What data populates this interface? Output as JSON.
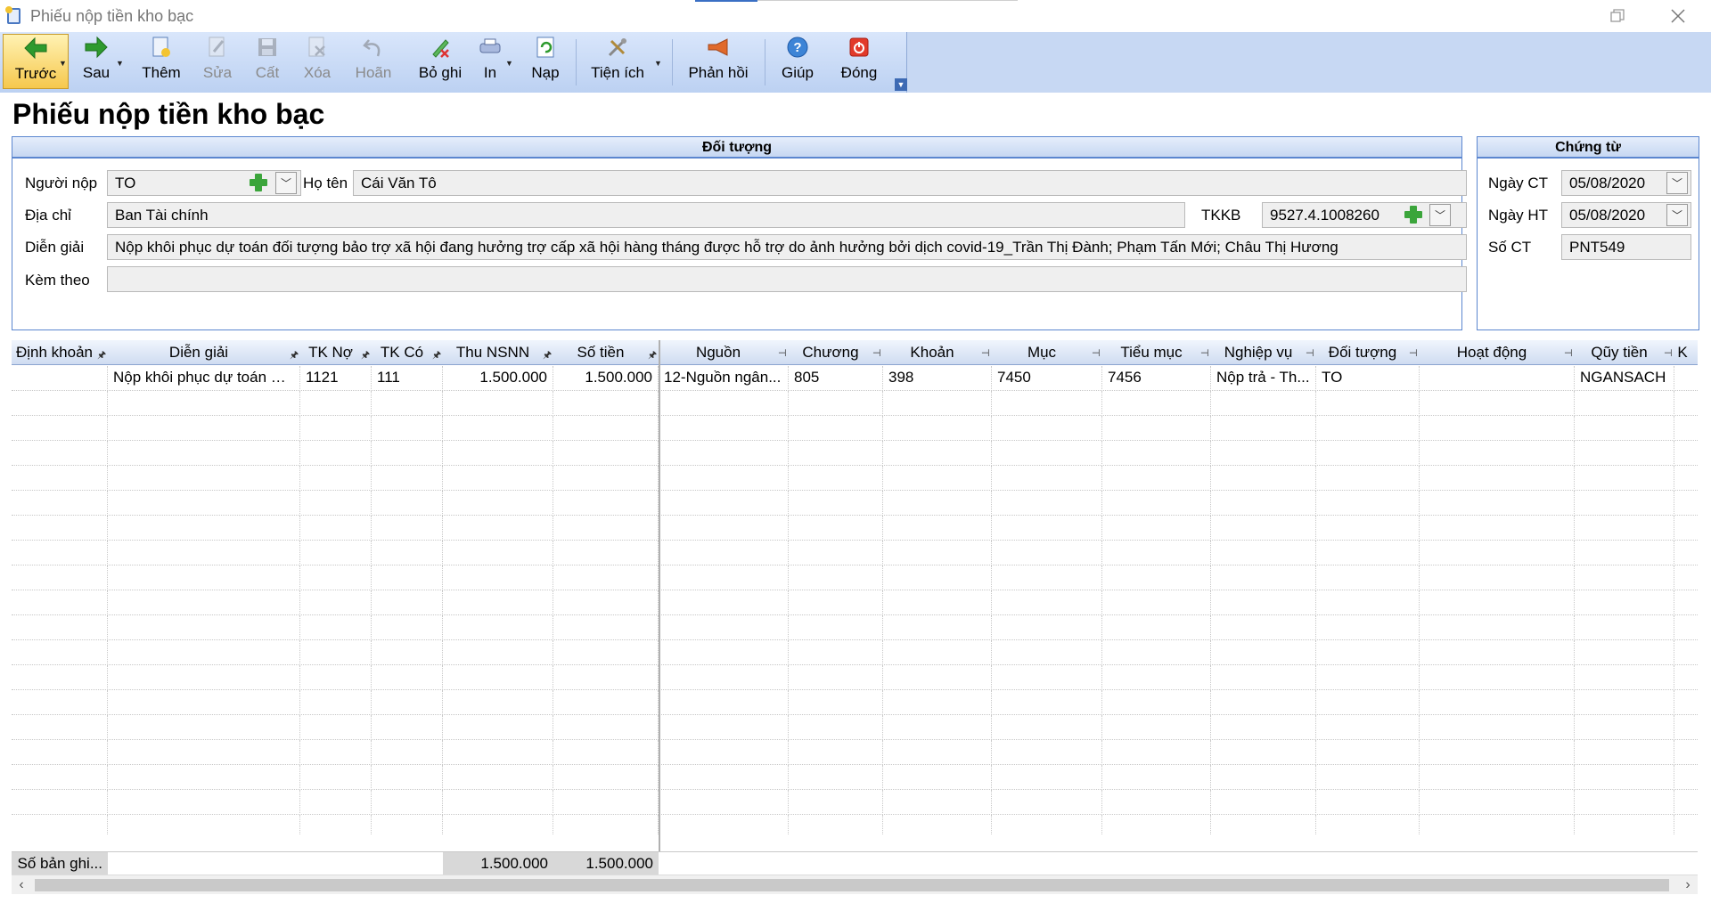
{
  "window": {
    "title": "Phiếu nộp tiền kho bạc",
    "restore_icon": "restore-icon",
    "close_icon": "close-icon"
  },
  "toolbar": {
    "prev": "Trước",
    "next": "Sau",
    "add": "Thêm",
    "edit": "Sửa",
    "save": "Cất",
    "delete": "Xóa",
    "undo": "Hoãn",
    "unpost": "Bỏ ghi",
    "print": "In",
    "reload": "Nạp",
    "utilities": "Tiện ích",
    "feedback": "Phản hồi",
    "help": "Giúp",
    "close": "Đóng"
  },
  "page_title": "Phiếu nộp tiền kho bạc",
  "doi_tuong": {
    "header": "Đối tượng",
    "nguoi_nop_label": "Người nộp",
    "nguoi_nop_value": "TO",
    "ho_ten_label": "Họ tên",
    "ho_ten_value": "Cái Văn Tô",
    "dia_chi_label": "Địa chỉ",
    "dia_chi_value": "Ban Tài chính",
    "tkkb_label": "TKKB",
    "tkkb_value": "9527.4.1008260",
    "dien_giai_label": "Diễn giải",
    "dien_giai_value": "Nộp khôi phục dự toán đối tượng bảo trợ xã hội đang hưởng trợ cấp xã hội hàng tháng được hỗ trợ do ảnh hưởng bởi dịch covid-19_Trần Thị Đành; Phạm Tấn Mới; Châu Thị Hương",
    "kem_theo_label": "Kèm theo",
    "kem_theo_value": ""
  },
  "chung_tu": {
    "header": "Chứng từ",
    "ngay_ct_label": "Ngày CT",
    "ngay_ct_value": "05/08/2020",
    "ngay_ht_label": "Ngày HT",
    "ngay_ht_value": "05/08/2020",
    "so_ct_label": "Số CT",
    "so_ct_value": "PNT549"
  },
  "grid": {
    "columns": [
      "Định khoản",
      "Diễn giải",
      "TK Nợ",
      "TK Có",
      "Thu NSNN",
      "Số tiền",
      "Nguồn",
      "Chương",
      "Khoản",
      "Mục",
      "Tiểu mục",
      "Nghiệp vụ",
      "Đối tượng",
      "Hoạt động",
      "Qũy tiền",
      "K"
    ],
    "rows": [
      [
        "",
        "Nộp khôi phục dự toán đố...",
        "1121",
        "111",
        "1.500.000",
        "1.500.000",
        "12-Nguồn  ngân...",
        "805",
        "398",
        "7450",
        "7456",
        "Nộp trả - Th...",
        "TO",
        "",
        "NGANSACH"
      ]
    ],
    "footer_label": "Số bản ghi...",
    "footer_thu_nsnn": "1.500.000",
    "footer_so_tien": "1.500.000"
  }
}
